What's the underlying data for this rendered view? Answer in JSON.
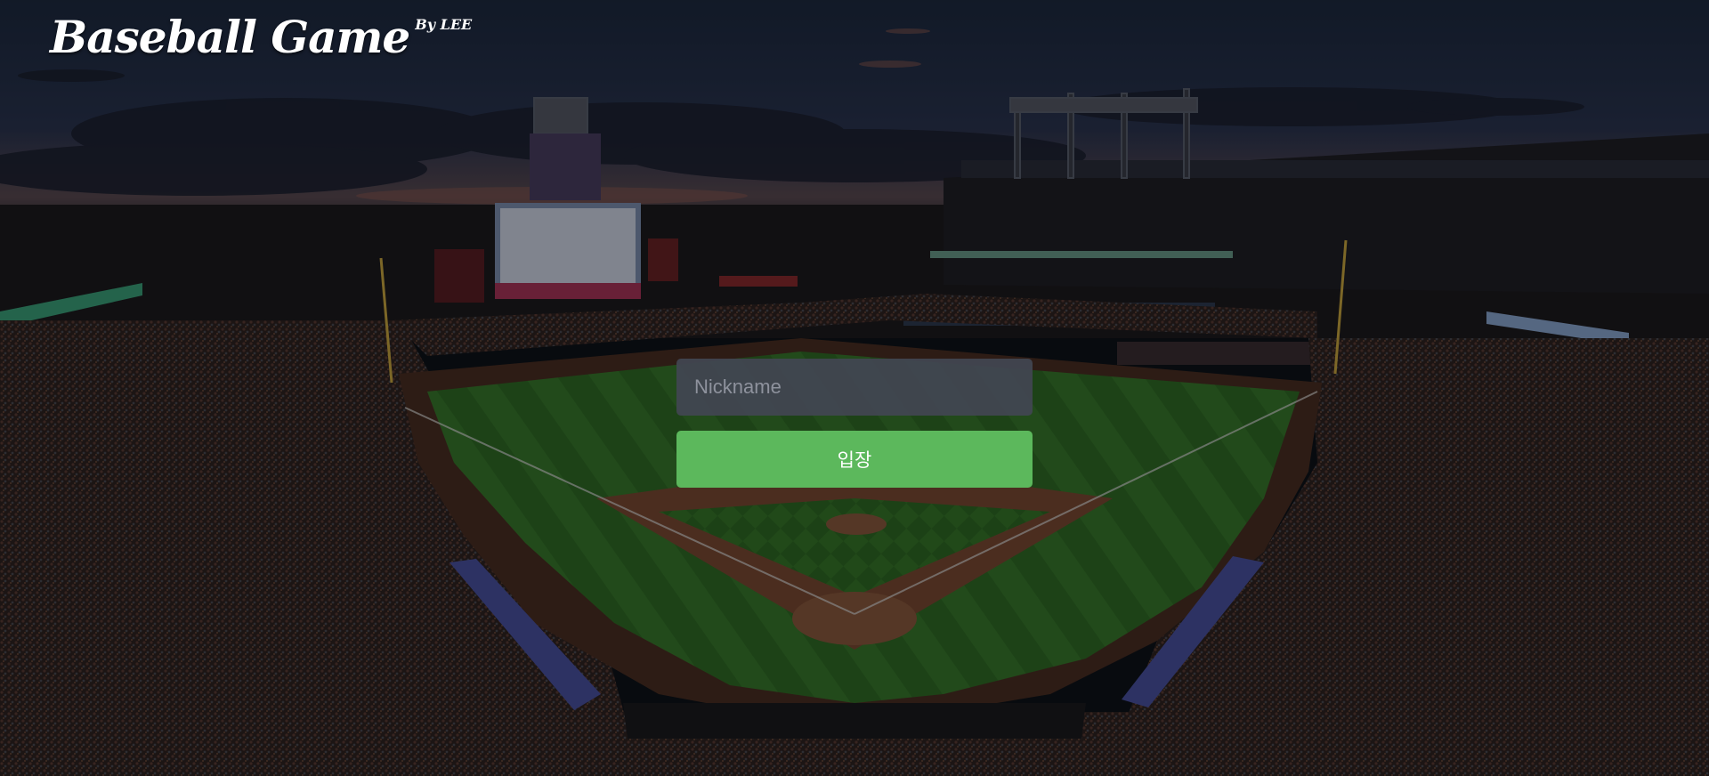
{
  "app": {
    "logo_title": "Baseball Game",
    "logo_byline": "By LEE"
  },
  "login": {
    "nickname_placeholder": "Nickname",
    "nickname_value": "",
    "enter_button_label": "입장"
  },
  "colors": {
    "enter_button": "#5cb85c",
    "input_background": "#424652",
    "outfield_grass": "#2f6b26",
    "infield_dirt": "#7a4a32",
    "sky": "#1a2a44"
  },
  "icons": {
    "logo_ball": "baseball-icon"
  }
}
